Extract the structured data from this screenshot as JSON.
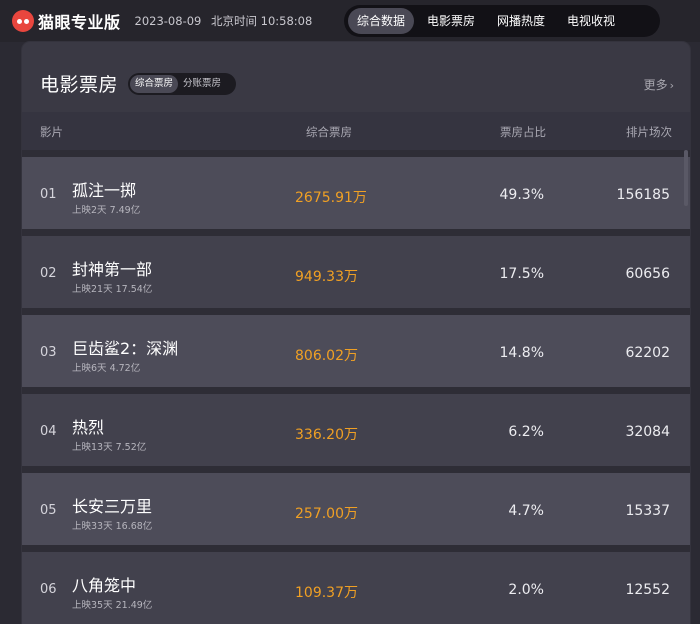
{
  "topbar": {
    "logo_text": "猫眼专业版",
    "date": "2023-08-09",
    "time": "北京时间 10:58:08",
    "tabs": [
      {
        "label": "综合数据",
        "active": true
      },
      {
        "label": "电影票房",
        "active": false
      },
      {
        "label": "网播热度",
        "active": false
      },
      {
        "label": "电视收视",
        "active": false
      }
    ]
  },
  "panel": {
    "title": "电影票房",
    "segment": [
      {
        "label": "综合票房",
        "active": true
      },
      {
        "label": "分账票房",
        "active": false
      }
    ],
    "more": "更多",
    "columns": {
      "film": "影片",
      "box": "综合票房",
      "pct": "票房占比",
      "shows": "排片场次"
    },
    "rows": [
      {
        "rank": "01",
        "name": "孤注一掷",
        "sub": "上映2天 7.49亿",
        "box": "2675.91万",
        "pct": "49.3%",
        "shows": "156185"
      },
      {
        "rank": "02",
        "name": "封神第一部",
        "sub": "上映21天 17.54亿",
        "box": "949.33万",
        "pct": "17.5%",
        "shows": "60656"
      },
      {
        "rank": "03",
        "name": "巨齿鲨2：深渊",
        "sub": "上映6天 4.72亿",
        "box": "806.02万",
        "pct": "14.8%",
        "shows": "62202"
      },
      {
        "rank": "04",
        "name": "热烈",
        "sub": "上映13天 7.52亿",
        "box": "336.20万",
        "pct": "6.2%",
        "shows": "32084"
      },
      {
        "rank": "05",
        "name": "长安三万里",
        "sub": "上映33天 16.68亿",
        "box": "257.00万",
        "pct": "4.7%",
        "shows": "15337"
      },
      {
        "rank": "06",
        "name": "八角笼中",
        "sub": "上映35天 21.49亿",
        "box": "109.37万",
        "pct": "2.0%",
        "shows": "12552"
      }
    ]
  },
  "colors": {
    "accent_box": "#f0a024",
    "logo_red": "#e8463e"
  }
}
